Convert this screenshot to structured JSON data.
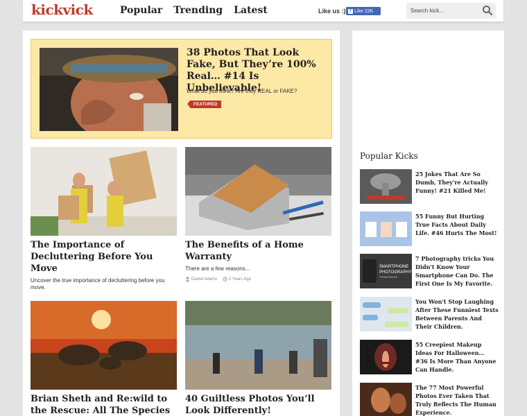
{
  "header": {
    "logo": "kickvick",
    "nav": [
      "Popular",
      "Trending",
      "Latest"
    ],
    "like_us": "Like us :)",
    "fb_like": "Like 22K",
    "search_placeholder": "Search kick..."
  },
  "featured": {
    "title": "38 Photos That Look Fake, But They’re 100% Real… #14 Is Unbelievable!",
    "description": "What do you think? Are they REAL or FAKE?",
    "tag": "FEATURED"
  },
  "cards": [
    {
      "title": "The Importance of Decluttering Before You Move",
      "excerpt": "Uncover the true importance of decluttering before you move."
    },
    {
      "title": "The Benefits of a Home Warranty",
      "excerpt": "There are a few reasons...",
      "author": "Daniel Adams",
      "time": "2 Years Ago"
    },
    {
      "title": "Brian Sheth and Re:wild to the Rescue: All The Species"
    },
    {
      "title": "40 Guiltless Photos You’ll Look Differently!"
    }
  ],
  "sidebar": {
    "heading": "Popular Kicks",
    "items": [
      {
        "title": "25 Jokes That Are So Dumb, They're Actually Funny! #21 Killed Me!"
      },
      {
        "title": "55 Funny But Hurting True Facts About Daily Life. #46 Hurts The Most!"
      },
      {
        "title": "7 Photography tricks You Didn't Know Your Smartphone Can Do. The First One Is My Favorite."
      },
      {
        "title": "You Won't Stop Laughing After These Funniest Texts Between Parents And Their Children."
      },
      {
        "title": "55 Creepiest Makeup Ideas For Halloween… #36 Is More Than Anyone Can Handle."
      },
      {
        "title": "The 77 Most Powerful Photos Ever Taken That Truly Reflects The Human Experience."
      }
    ],
    "thumb_texts": {
      "smartphone": "SMARTPHONE",
      "photography": "PHOTOGRAPHY",
      "tips": "TIPS&TRICKS"
    }
  },
  "colors": {
    "brand": "#c0392b",
    "featured_bg": "#fde9a6",
    "facebook": "#4267b2"
  }
}
